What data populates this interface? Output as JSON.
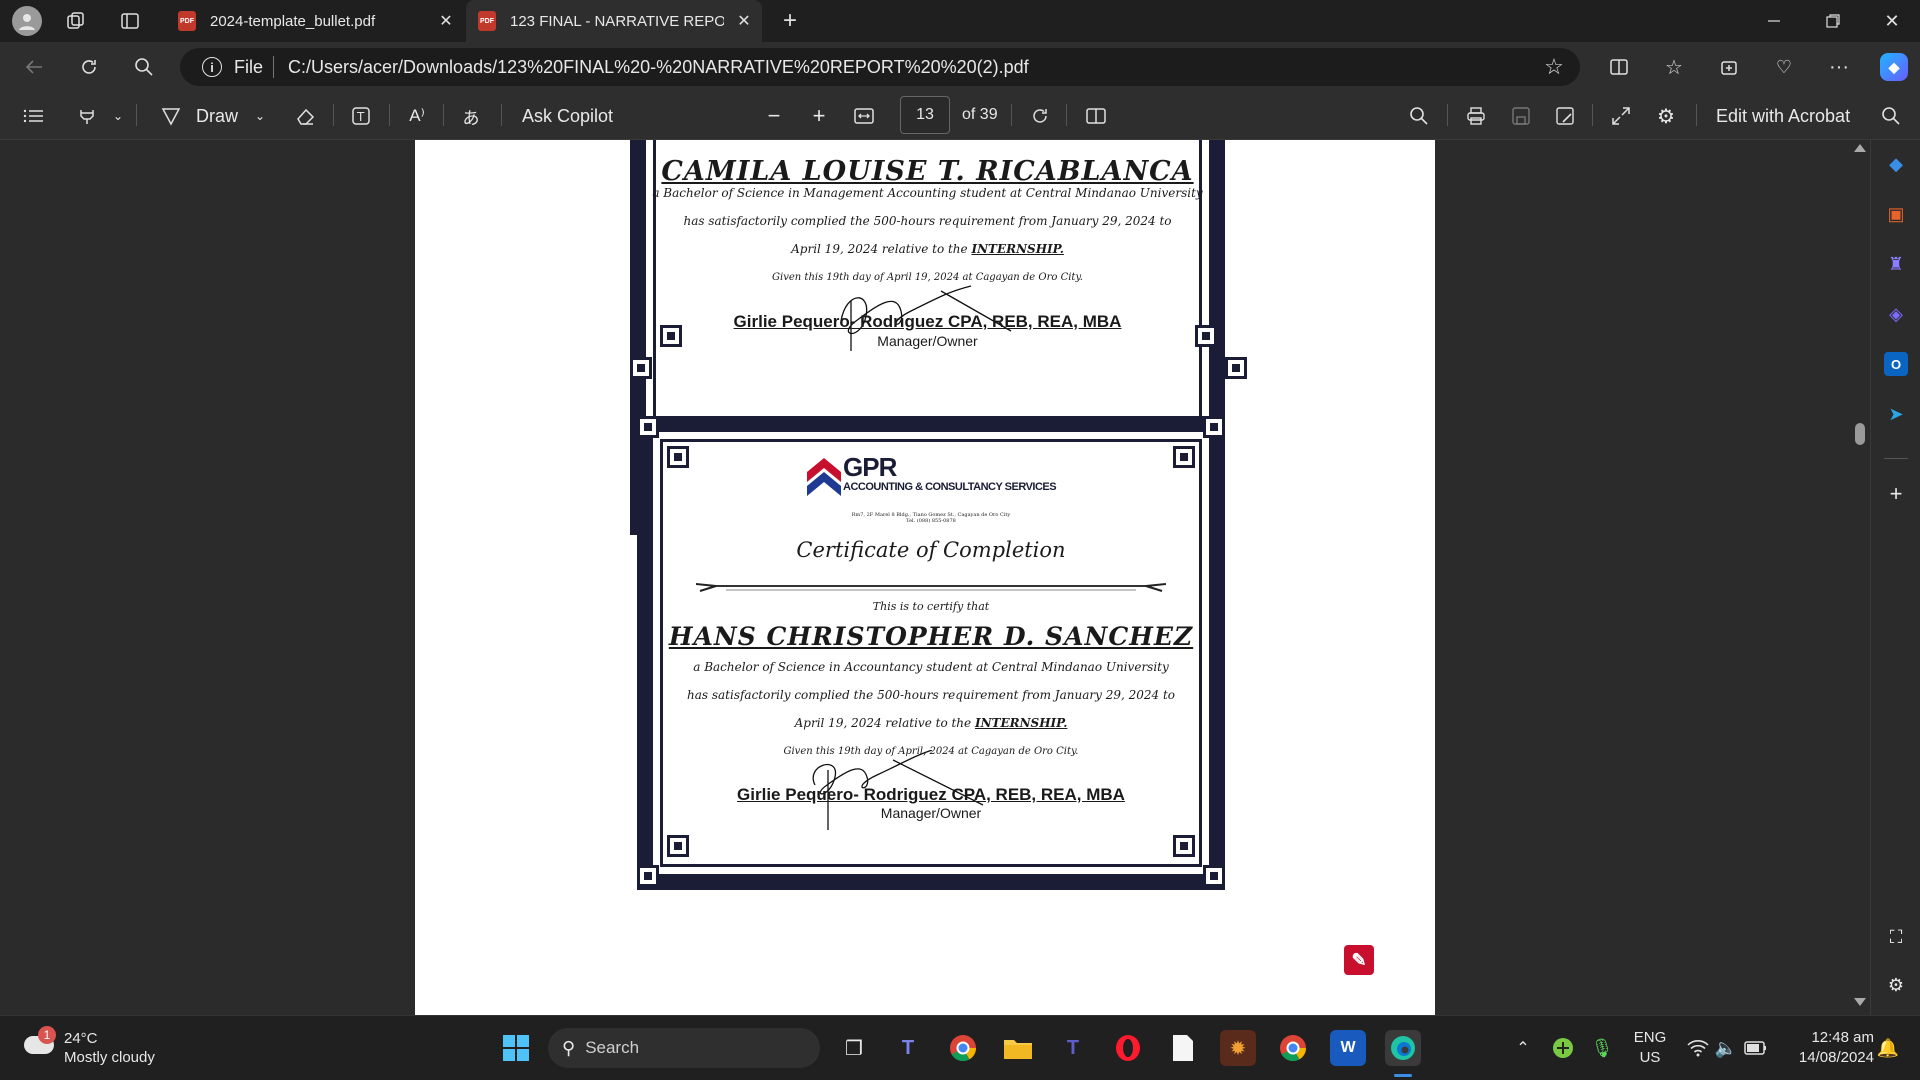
{
  "browser": {
    "tabs": [
      {
        "label": "2024-template_bullet.pdf",
        "active": false
      },
      {
        "label": "123 FINAL - NARRATIVE REPORT",
        "active": true
      }
    ],
    "file_label": "File",
    "url": "C:/Users/acer/Downloads/123%20FINAL%20-%20NARRATIVE%20REPORT%20%20(2).pdf"
  },
  "pdf_toolbar": {
    "draw_label": "Draw",
    "ask_copilot_label": "Ask Copilot",
    "page_current": "13",
    "page_total": "of 39",
    "edit_acrobat_label": "Edit with Acrobat"
  },
  "document": {
    "cert1": {
      "name_partial": "CAMILA LOUISE T. RICABLANCA",
      "line1": "a Bachelor of Science in Management Accounting student at Central Mindanao University",
      "line2": "has satisfactorily complied the 500-hours requirement from January 29, 2024 to",
      "line3_pre": "April 19, 2024 relative to the ",
      "line3_bold": "INTERNSHIP.",
      "given": "Given this 19th day of April 19, 2024 at Cagayan de Oro City.",
      "signer": "Girlie Pequero- Rodriguez CPA, REB, REA, MBA",
      "role": "Manager/Owner"
    },
    "cert2": {
      "logo_name": "GPR",
      "logo_sub": "ACCOUNTING & CONSULTANCY SERVICES",
      "logo_address": "Rm7, 2F Marel 8 Bldg., Tiano Gomez St., Cagayan de Oro City",
      "logo_tel": "Tel. (088) 855-0878",
      "title": "Certificate of Completion",
      "certify": "This is to certify that",
      "name": "HANS CHRISTOPHER D. SANCHEZ",
      "line1": "a Bachelor of Science in Accountancy student at Central Mindanao University",
      "line2": "has satisfactorily complied the 500-hours requirement from January 29, 2024 to",
      "line3_pre": "April 19, 2024 relative to the ",
      "line3_bold": "INTERNSHIP.",
      "given": "Given this 19th day of April, 2024 at Cagayan de Oro City.",
      "signer": "Girlie Pequero- Rodriguez CPA, REB, REA, MBA",
      "role": "Manager/Owner"
    }
  },
  "taskbar": {
    "weather_temp": "24°C",
    "weather_desc": "Mostly cloudy",
    "weather_badge": "1",
    "search_label": "Search",
    "lang": "ENG",
    "region": "US",
    "time": "12:48 am",
    "date": "14/08/2024"
  },
  "colors": {
    "cert_border": "#1a1d35",
    "logo_red": "#c8102e",
    "logo_blue": "#1f3a93",
    "edge_accent": "#3a8ee6"
  }
}
